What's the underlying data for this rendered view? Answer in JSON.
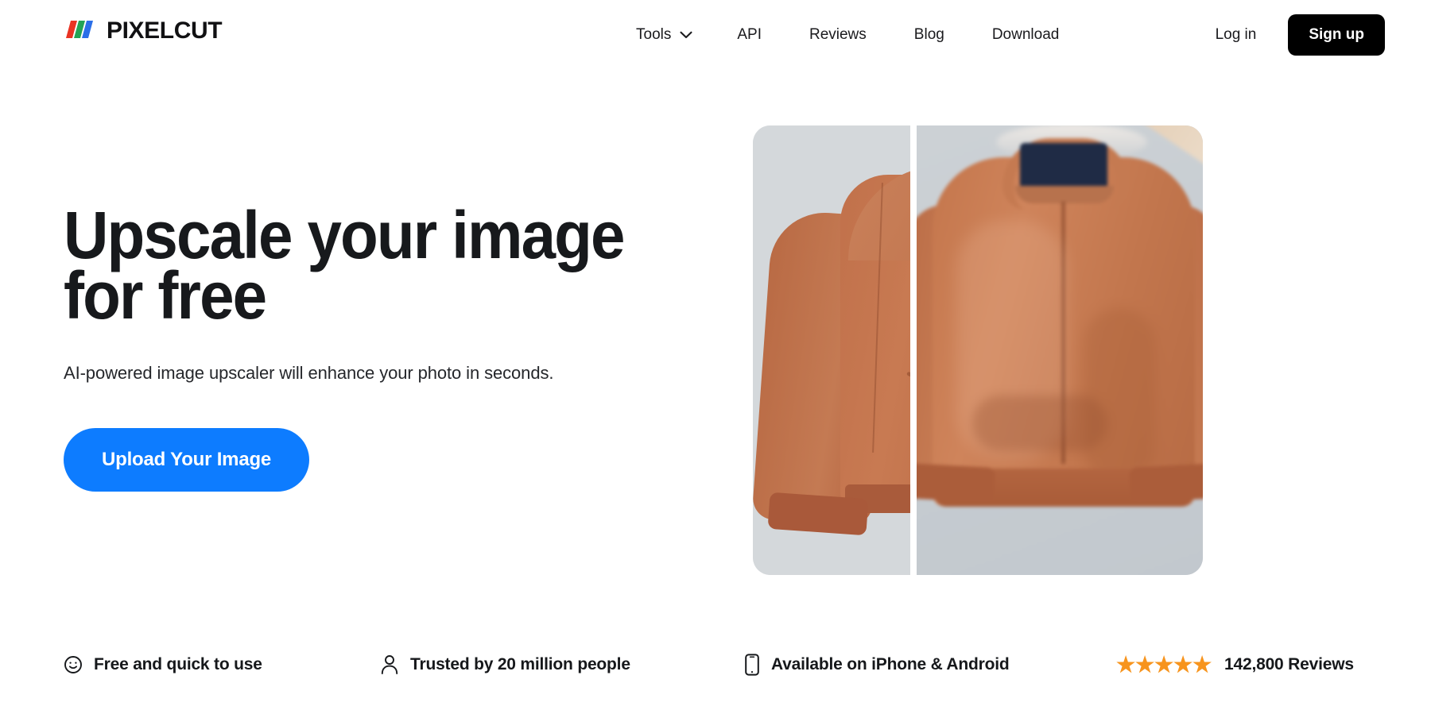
{
  "brand": {
    "name": "PIXELCUT",
    "logo_icon": "pixelcut-slashes-logo",
    "logo_colors": [
      "#ea3323",
      "#23a455",
      "#2b6fe8"
    ]
  },
  "nav": {
    "items": [
      {
        "label": "Tools",
        "has_dropdown": true,
        "icon": "chevron-down-icon"
      },
      {
        "label": "API",
        "has_dropdown": false
      },
      {
        "label": "Reviews",
        "has_dropdown": false
      },
      {
        "label": "Blog",
        "has_dropdown": false
      },
      {
        "label": "Download",
        "has_dropdown": false
      }
    ],
    "login_label": "Log in",
    "signup_label": "Sign up",
    "signup_bg": "#000000",
    "signup_fg": "#ffffff"
  },
  "hero": {
    "title": "Upscale your image for free",
    "subtitle": "AI-powered image upscaler will enhance your photo in seconds.",
    "cta_label": "Upload Your Image",
    "cta_color": "#0d7cff",
    "image": {
      "alt": "Before and after upscaling comparison of an orange bomber jacket",
      "before_label": "",
      "after_label": ""
    }
  },
  "trust_bar": {
    "items": [
      {
        "icon": "smiley-face-icon",
        "label": "Free and quick to use"
      },
      {
        "icon": "person-icon",
        "label": "Trusted by 20 million people"
      },
      {
        "icon": "mobile-phone-icon",
        "label": "Available on iPhone & Android"
      },
      {
        "icon": "star-rating-icon",
        "label": "142,800 Reviews",
        "stars": "★★★★★",
        "star_color": "#f7941d"
      }
    ]
  }
}
